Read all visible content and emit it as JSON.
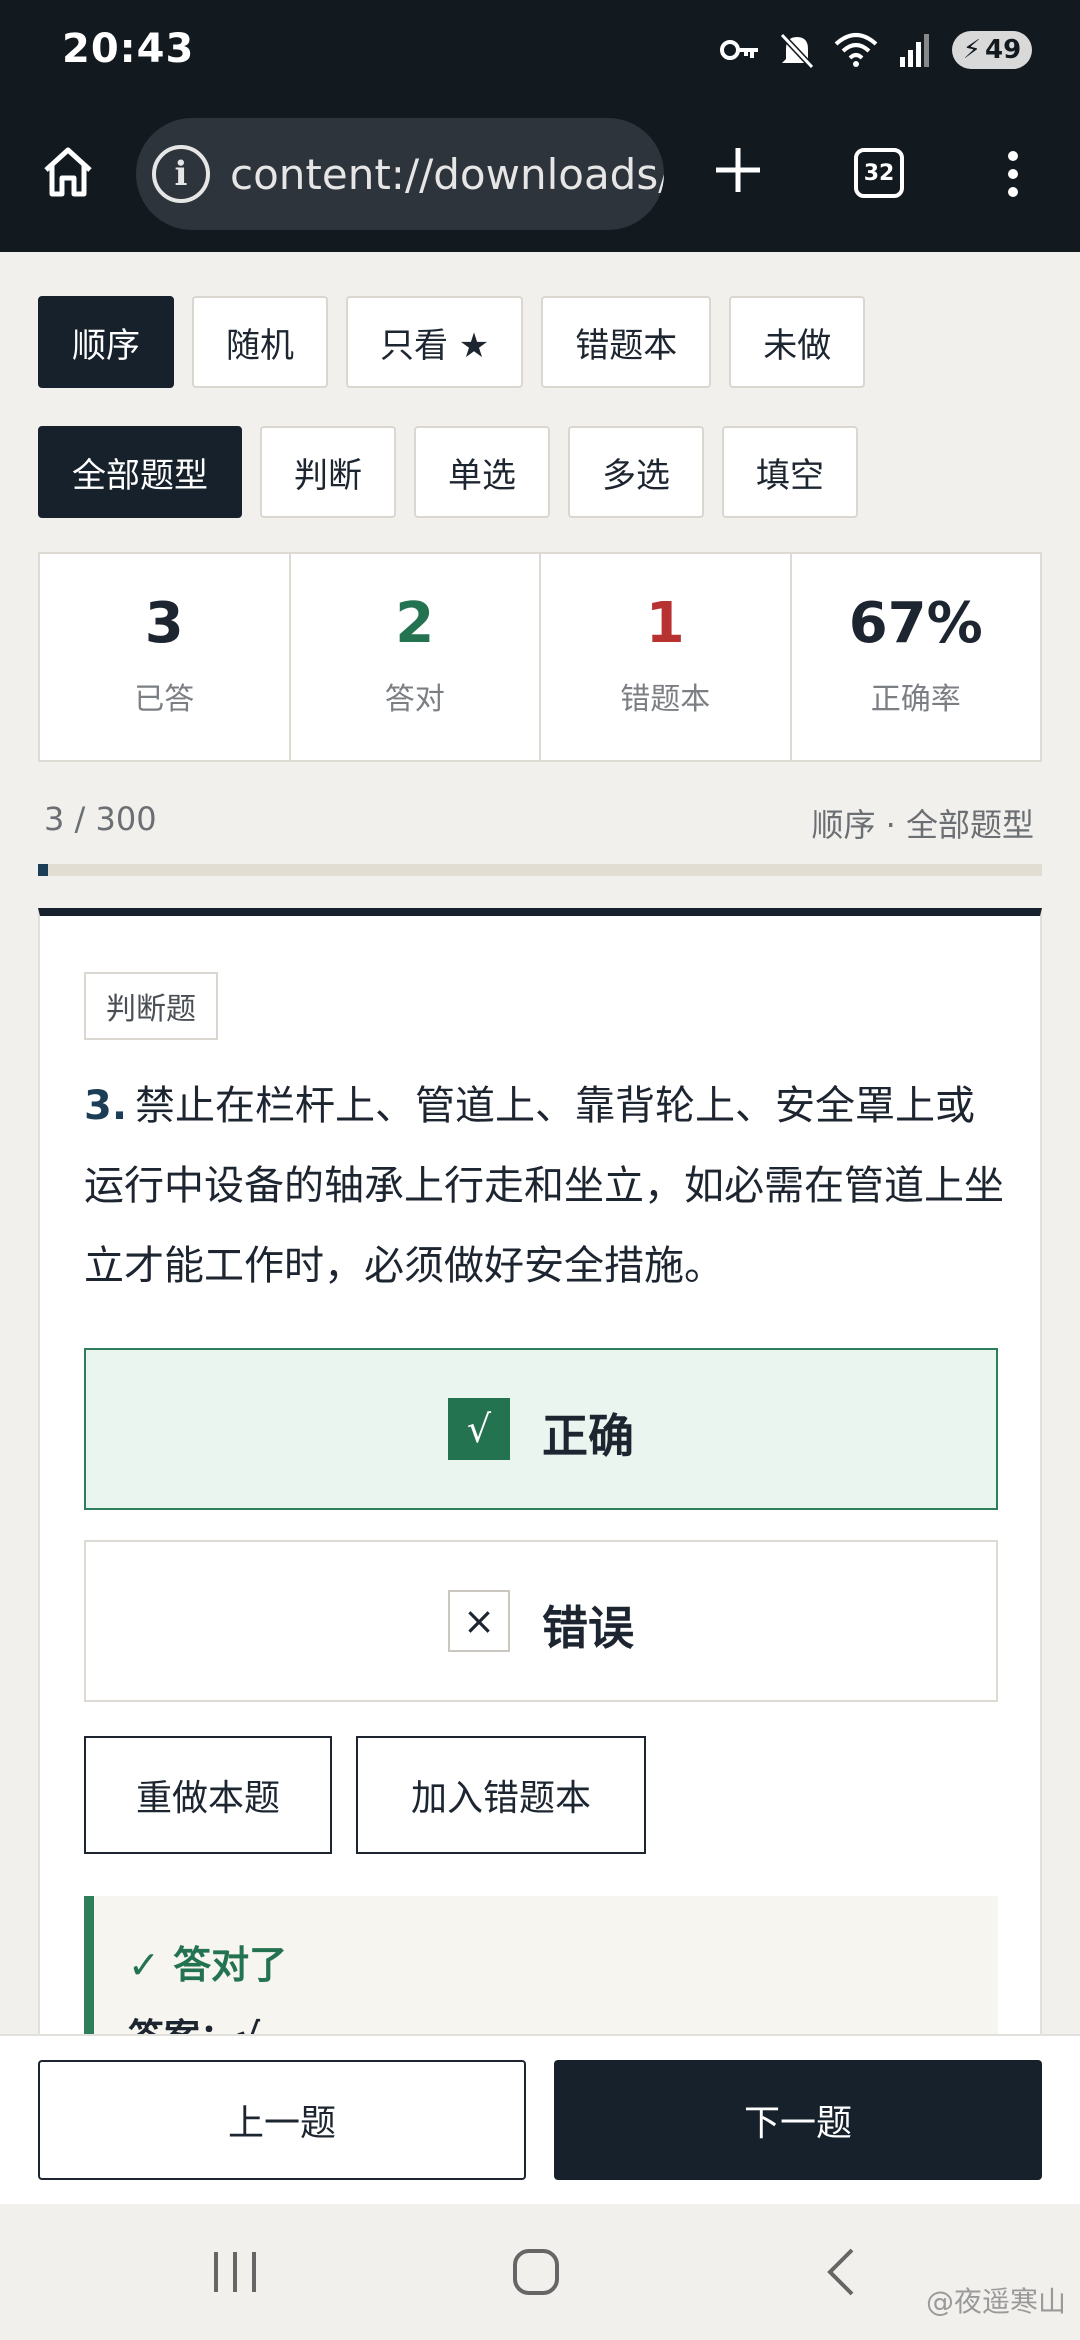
{
  "status": {
    "time": "20:43",
    "battery": "49",
    "icons": [
      "key-icon",
      "mute-icon",
      "wifi-icon",
      "signal-icon",
      "battery-icon"
    ]
  },
  "browser": {
    "url": "content://downloads/",
    "tab_count": "32"
  },
  "modes": [
    {
      "label": "顺序",
      "active": true
    },
    {
      "label": "随机",
      "active": false
    },
    {
      "label": "只看 ★",
      "active": false
    },
    {
      "label": "错题本",
      "active": false
    },
    {
      "label": "未做",
      "active": false
    }
  ],
  "types": [
    {
      "label": "全部题型",
      "active": true
    },
    {
      "label": "判断",
      "active": false
    },
    {
      "label": "单选",
      "active": false
    },
    {
      "label": "多选",
      "active": false
    },
    {
      "label": "填空",
      "active": false
    }
  ],
  "stats": [
    {
      "value": "3",
      "label": "已答",
      "color": "#1c2530"
    },
    {
      "value": "2",
      "label": "答对",
      "color": "#237350"
    },
    {
      "value": "1",
      "label": "错题本",
      "color": "#b83232"
    },
    {
      "value": "67%",
      "label": "正确率",
      "color": "#1c2530"
    }
  ],
  "progress": {
    "count": "3 / 300",
    "mode": "顺序 · 全部题型",
    "fraction": 0.01
  },
  "question": {
    "type_badge": "判断题",
    "number": "3.",
    "text": "禁止在栏杆上、管道上、靠背轮上、安全罩上或运行中设备的轴承上行走和坐立，如必需在管道上坐立才能工作时，必须做好安全措施。",
    "options": [
      {
        "mark": "√",
        "label": "正确"
      },
      {
        "mark": "×",
        "label": "错误"
      }
    ],
    "redo_label": "重做本题",
    "add_wrong_label": "加入错题本",
    "feedback_title": "✓ 答对了",
    "feedback_answer": "答案：√"
  },
  "nav": {
    "prev_label": "上一题",
    "next_label": "下一题"
  },
  "watermark": "@夜遥寒山",
  "colors": {
    "accent_dark": "#17212b",
    "correct_green": "#237350",
    "wrong_red": "#b83232"
  }
}
